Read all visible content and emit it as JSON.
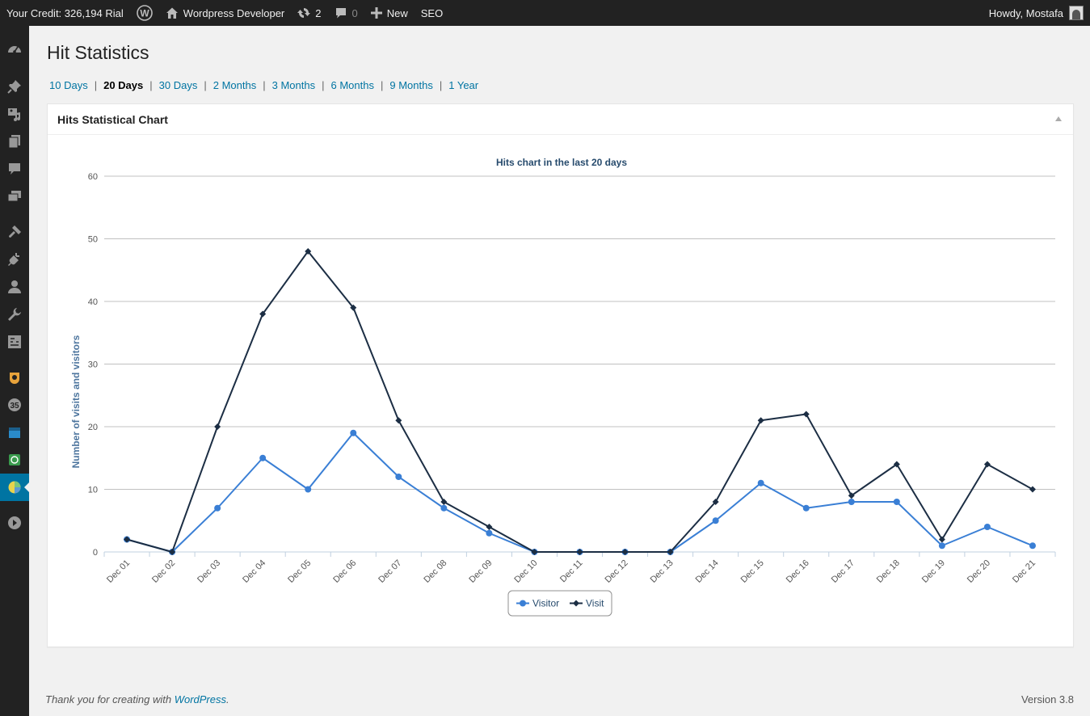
{
  "adminbar": {
    "credit": "Your Credit: 326,194 Rial",
    "site_name": "Wordpress Developer",
    "updates_count": "2",
    "comments_count": "0",
    "new_label": "New",
    "seo_label": "SEO",
    "howdy": "Howdy, Mostafa"
  },
  "page": {
    "title": "Hit Statistics",
    "filters": [
      {
        "label": "10 Days",
        "current": false
      },
      {
        "label": "20 Days",
        "current": true
      },
      {
        "label": "30 Days",
        "current": false
      },
      {
        "label": "2 Months",
        "current": false
      },
      {
        "label": "3 Months",
        "current": false
      },
      {
        "label": "6 Months",
        "current": false
      },
      {
        "label": "9 Months",
        "current": false
      },
      {
        "label": "1 Year",
        "current": false
      }
    ],
    "filter_separator": "|"
  },
  "postbox": {
    "title": "Hits Statistical Chart"
  },
  "chart_data": {
    "type": "line",
    "title": "Hits chart in the last 20 days",
    "xlabel": "",
    "ylabel": "Number of visits and visitors",
    "ylim": [
      0,
      60
    ],
    "yticks": [
      0,
      10,
      20,
      30,
      40,
      50,
      60
    ],
    "grid": true,
    "legend_position": "bottom-center",
    "categories": [
      "Dec 01",
      "Dec 02",
      "Dec 03",
      "Dec 04",
      "Dec 05",
      "Dec 06",
      "Dec 07",
      "Dec 08",
      "Dec 09",
      "Dec 10",
      "Dec 11",
      "Dec 12",
      "Dec 13",
      "Dec 14",
      "Dec 15",
      "Dec 16",
      "Dec 17",
      "Dec 18",
      "Dec 19",
      "Dec 20",
      "Dec 21"
    ],
    "series": [
      {
        "name": "Visitor",
        "color": "#3a7fd5",
        "marker": "circle",
        "values": [
          2,
          0,
          7,
          15,
          10,
          19,
          12,
          7,
          3,
          0,
          0,
          0,
          0,
          5,
          11,
          7,
          8,
          8,
          1,
          4,
          1
        ]
      },
      {
        "name": "Visit",
        "color": "#1c2e44",
        "marker": "diamond",
        "values": [
          2,
          0,
          20,
          38,
          48,
          39,
          21,
          8,
          4,
          0,
          0,
          0,
          0,
          8,
          21,
          22,
          9,
          14,
          2,
          14,
          10
        ]
      }
    ]
  },
  "footer": {
    "thanks_prefix": "Thank you for creating with ",
    "thanks_link": "WordPress",
    "thanks_suffix": ".",
    "version": "Version 3.8"
  }
}
